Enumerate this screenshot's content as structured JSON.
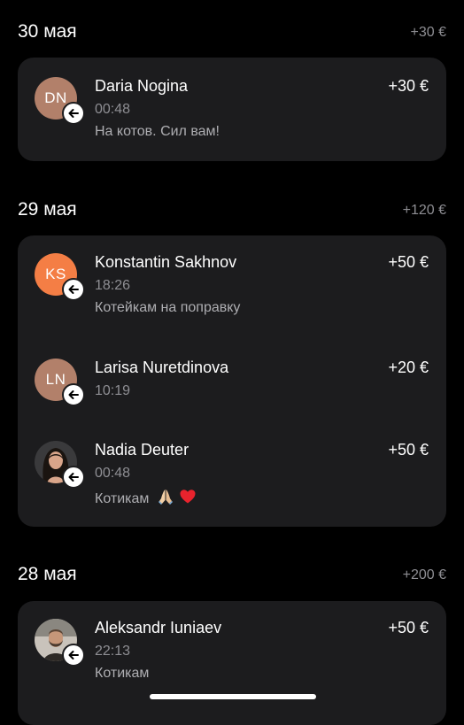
{
  "sections": [
    {
      "date": "30 мая",
      "total": "+30 €",
      "transfers": [
        {
          "initials": "DN",
          "avatar_color": "#b2806a",
          "name": "Daria Nogina",
          "amount": "+30 €",
          "time": "00:48",
          "comment": "На котов. Сил вам!"
        }
      ]
    },
    {
      "date": "29 мая",
      "total": "+120 €",
      "transfers": [
        {
          "initials": "KS",
          "avatar_color": "#f47e45",
          "name": "Konstantin Sakhnov",
          "amount": "+50 €",
          "time": "18:26",
          "comment": "Котейкам на поправку"
        },
        {
          "initials": "LN",
          "avatar_color": "#b2806a",
          "name": "Larisa Nuretdinova",
          "amount": "+20 €",
          "time": "10:19"
        },
        {
          "avatar_icon": "person-photo",
          "name": "Nadia Deuter",
          "amount": "+50 €",
          "time": "00:48",
          "comment": "Котикам",
          "comment_emoji": [
            "folded-hands-icon",
            "red-heart-icon"
          ]
        }
      ]
    },
    {
      "date": "28 мая",
      "total": "+200 €",
      "transfers": [
        {
          "avatar_icon": "person-photo",
          "name": "Aleksandr Iuniaev",
          "amount": "+50 €",
          "time": "22:13",
          "comment": "Котикам"
        }
      ]
    }
  ],
  "badge_icon": "incoming-arrow-icon"
}
